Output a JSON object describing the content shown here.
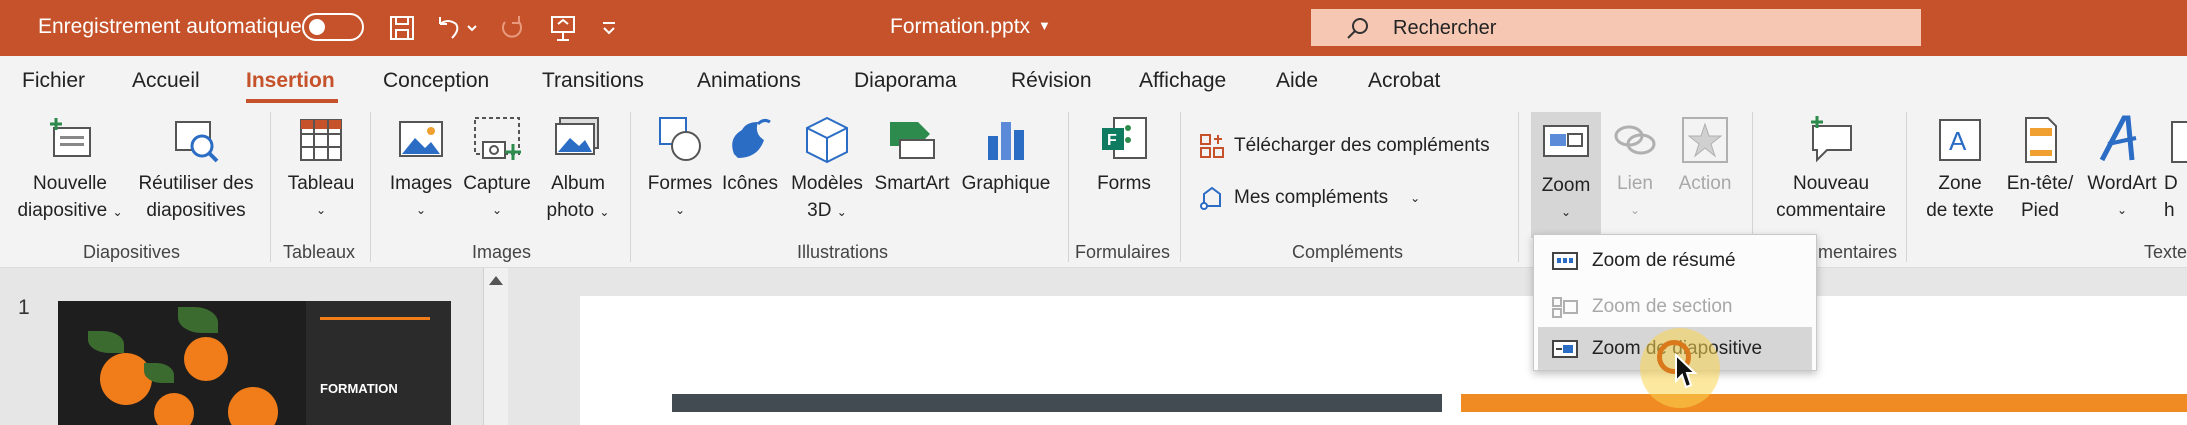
{
  "titlebar": {
    "autosave_label": "Enregistrement automatique",
    "file_name": "Formation.pptx",
    "search_label": "Rechercher"
  },
  "tabs": [
    "Fichier",
    "Accueil",
    "Insertion",
    "Conception",
    "Transitions",
    "Animations",
    "Diaporama",
    "Révision",
    "Affichage",
    "Aide",
    "Acrobat"
  ],
  "active_tab": "Insertion",
  "ribbon": {
    "new_slide": [
      "Nouvelle",
      "diapositive"
    ],
    "reuse_slides": [
      "Réutiliser des",
      "diapositives"
    ],
    "group_slides": "Diapositives",
    "table": "Tableau",
    "group_tables": "Tableaux",
    "images": "Images",
    "capture": "Capture",
    "album": [
      "Album",
      "photo"
    ],
    "group_images": "Images",
    "shapes": "Formes",
    "icons": "Icônes",
    "models_3d": [
      "Modèles",
      "3D"
    ],
    "smartart": "SmartArt",
    "chart": "Graphique",
    "group_illustrations": "Illustrations",
    "forms": "Forms",
    "group_forms": "Formulaires",
    "get_addins": "Télécharger des compléments",
    "my_addins": "Mes compléments",
    "group_addins": "Compléments",
    "zoom": "Zoom",
    "link": "Lien",
    "action": "Action",
    "new_comment": [
      "Nouveau",
      "commentaire"
    ],
    "group_comments_partial": "mentaires",
    "textbox": [
      "Zone",
      "de texte"
    ],
    "header_footer": [
      "En-tête/",
      "Pied"
    ],
    "wordart": "WordArt",
    "partial_d": "D",
    "partial_h": "h",
    "group_text_partial": "Texte"
  },
  "zoom_menu": {
    "items": [
      {
        "label": "Zoom de résumé",
        "enabled": true
      },
      {
        "label": "Zoom de section",
        "enabled": false
      },
      {
        "label": "Zoom de diapositive",
        "enabled": true
      }
    ]
  },
  "slides_panel": {
    "slide_number": "1",
    "thumb_title": "FORMATION"
  },
  "colors": {
    "brand": "#c5522a",
    "accent_orange": "#f08a22",
    "dark_bar": "#414b51"
  }
}
